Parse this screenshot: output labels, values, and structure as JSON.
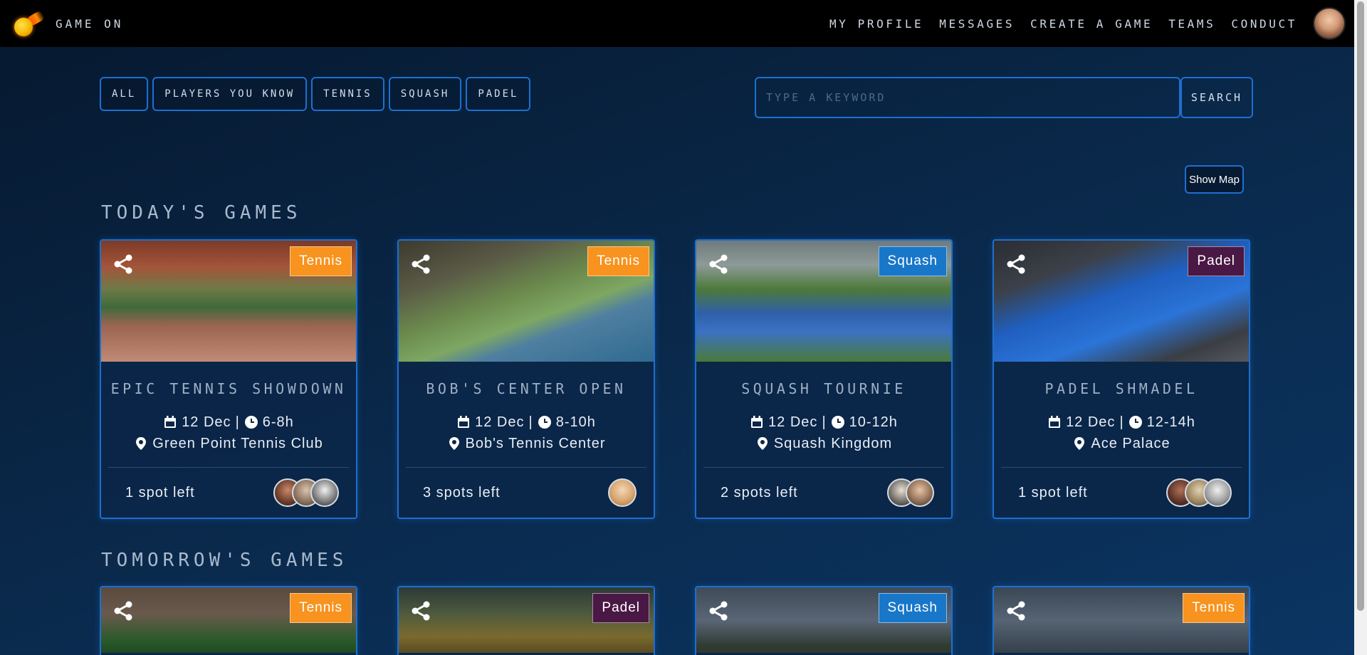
{
  "nav": {
    "brand": "GAME ON",
    "links": [
      "MY PROFILE",
      "MESSAGES",
      "CREATE A GAME",
      "TEAMS",
      "CONDUCT"
    ]
  },
  "filters": [
    "ALL",
    "PLAYERS YOU KNOW",
    "TENNIS",
    "SQUASH",
    "PADEL"
  ],
  "search": {
    "placeholder": "TYPE A KEYWORD",
    "button": "SEARCH"
  },
  "map_button": "Show Map",
  "sections": {
    "today": "TODAY'S GAMES",
    "tomorrow": "TOMORROW'S GAMES"
  },
  "today_games": [
    {
      "title": "EPIC TENNIS SHOWDOWN",
      "sport": "Tennis",
      "date": "12 Dec",
      "time": "6-8h",
      "location": "Green Point Tennis Club",
      "spots": "1 spot left"
    },
    {
      "title": "BOB'S CENTER OPEN",
      "sport": "Tennis",
      "date": "12 Dec",
      "time": "8-10h",
      "location": "Bob's Tennis Center",
      "spots": "3 spots left"
    },
    {
      "title": "SQUASH TOURNIE",
      "sport": "Squash",
      "date": "12 Dec",
      "time": "10-12h",
      "location": "Squash Kingdom",
      "spots": "2 spots left"
    },
    {
      "title": "PADEL SHMADEL",
      "sport": "Padel",
      "date": "12 Dec",
      "time": "12-14h",
      "location": "Ace Palace",
      "spots": "1 spot left"
    }
  ],
  "tomorrow_games": [
    {
      "sport": "Tennis"
    },
    {
      "sport": "Padel"
    },
    {
      "sport": "Squash"
    },
    {
      "sport": "Tennis"
    }
  ],
  "colors": {
    "accent": "#1e6fd0",
    "tennis": "#f7931e",
    "squash": "#1877c9",
    "padel": "#4a1845"
  }
}
